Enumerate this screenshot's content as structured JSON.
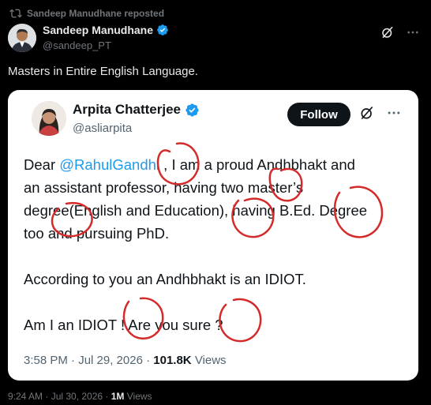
{
  "repost": {
    "text": "Sandeep Manudhane reposted",
    "icon": "repost-icon"
  },
  "author": {
    "name": "Sandeep Manudhane",
    "handle": "@sandeep_PT",
    "verified": true
  },
  "post": {
    "text": "Masters in Entire English Language."
  },
  "quote": {
    "author": {
      "name": "Arpita Chatterjee",
      "handle": "@asliarpita",
      "verified": true
    },
    "follow_label": "Follow",
    "body": {
      "line1_pre": "Dear ",
      "mention": "@RahulGandhi",
      "line1_post": " , I am a proud Andhbhakt and",
      "line2": "an assistant professor, having two master’s",
      "line3": "degree(English and Education), having B.Ed. Degree",
      "line4": "too and pursuing PhD.",
      "line5": "According to you an Andhbhakt is an IDIOT.",
      "line6": "Am I an IDIOT ! Are you sure ?"
    },
    "time": "3:58 PM · Jul 29, 2026 ·",
    "views_count": "101.8K",
    "views_label": "Views"
  },
  "footer": {
    "time": "9:24 AM · Jul 30, 2026 ·",
    "views_count": "1M",
    "views_label": "Views"
  },
  "colors": {
    "background": "#000000",
    "accent": "#1d9bf0",
    "annotation": "#d42a2a",
    "card": "#ffffff"
  }
}
